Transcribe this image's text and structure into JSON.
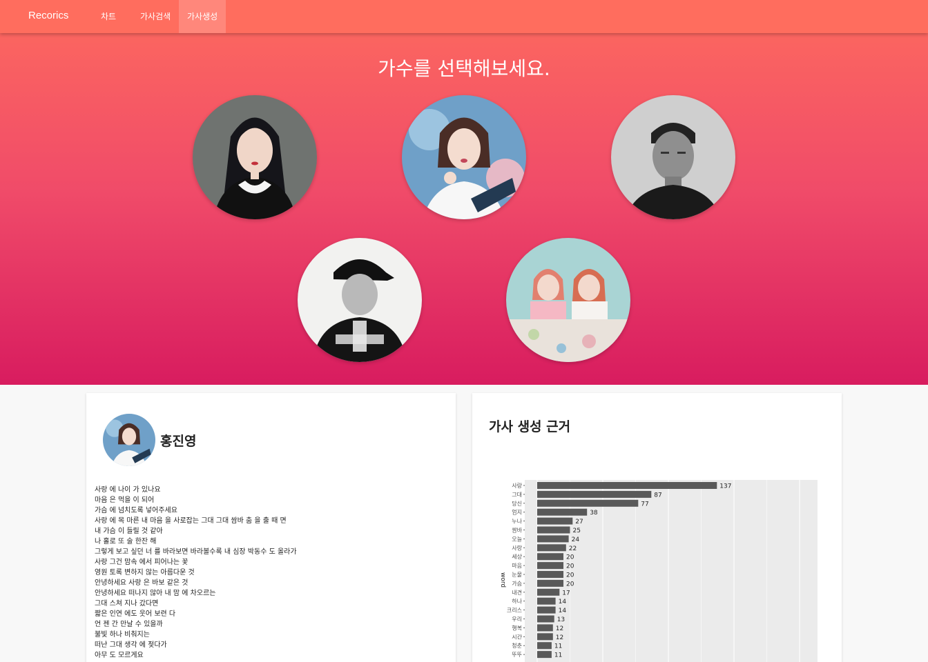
{
  "navbar": {
    "brand": "Recorics",
    "items": [
      {
        "label": "차트",
        "active": false
      },
      {
        "label": "가사검색",
        "active": false
      },
      {
        "label": "가사생성",
        "active": true
      }
    ],
    "color": "#ff6d5e"
  },
  "hero": {
    "title": "가수를 선택해보세요.",
    "gradient": [
      "#fb6560",
      "#d81c5f"
    ],
    "artists": [
      {
        "photo": "artist-photo-1"
      },
      {
        "photo": "artist-photo-2"
      },
      {
        "photo": "artist-photo-3"
      },
      {
        "photo": "artist-photo-4"
      },
      {
        "photo": "artist-photo-5"
      }
    ]
  },
  "selected": {
    "name": "홍진영",
    "lyrics": [
      "사랑 에 나이 가 있나요",
      "마음 은 먹을 이 되어",
      "가슴 에 넘치도록 넣어주세요",
      "사랑 에 목 마른 내 마음 을 사로잡는 그대 그대 쌈바 춤 을 출 때 면",
      "내 가슴 이 들릴 것 같아",
      "나 홀로 또 술 한잔 해",
      "그렇게 보고 싶던 너 를 바라보면 바라볼수록 내 심장 박동수 도 올라가",
      "사랑 그건 맘속 에서 피어나는 꽃",
      "영원 토록 변하지 않는 아름다운 것",
      "안녕하세요 사랑 은 바보 같은 것",
      "안녕하세요 떠나지 않아 내 맘 에 차오르는",
      "그대 스쳐 지나 갔다면",
      "짧은 인연 에도 웃어 보련 다",
      "언 젠 간 만날 수 있을까",
      "불빛 하나 비춰지는",
      "떠난 그대 생각 에 젖다가",
      "아무 도 모르게요"
    ]
  },
  "chart_panel": {
    "title": "가사 생성 근거"
  },
  "chart_data": {
    "type": "bar",
    "orientation": "horizontal",
    "ylabel": "word",
    "categories": [
      "사랑",
      "그대",
      "당신",
      "엄지",
      "누나",
      "쌈바",
      "오늘",
      "사랑",
      "세상",
      "마음",
      "눈물",
      "가슴",
      "내견",
      "하나",
      "크리스",
      "우리",
      "행복",
      "시간",
      "청춘",
      "뚜뚜"
    ],
    "values": [
      137,
      87,
      77,
      38,
      27,
      25,
      24,
      22,
      20,
      20,
      20,
      20,
      17,
      14,
      14,
      13,
      12,
      12,
      11,
      11
    ],
    "bar_color": "#595959",
    "panel_color": "#ebebeb",
    "grid": true
  }
}
